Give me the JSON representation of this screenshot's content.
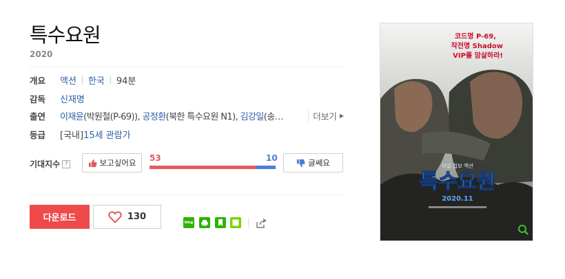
{
  "movie": {
    "title": "특수요원",
    "year": "2020"
  },
  "info": {
    "overview_label": "개요",
    "genre": "액션",
    "country": "한국",
    "runtime": "94분",
    "director_label": "감독",
    "director": "신재명",
    "cast_label": "출연",
    "cast": [
      {
        "name": "이재윤",
        "role": "(박원철(P-69)), "
      },
      {
        "name": "공정환",
        "role": "(북한 특수요원 N1), "
      },
      {
        "name": "김강일",
        "role": "(송…"
      }
    ],
    "more_label": "더보기",
    "rating_label": "등급",
    "rating_prefix": "[국내] ",
    "rating": "15세 관람가"
  },
  "expect": {
    "label": "기대지수",
    "help": "?",
    "want_label": "보고싶어요",
    "no_label": "글쎄요",
    "want_count": "53",
    "no_count": "10",
    "want_ratio": 0.8413
  },
  "actions": {
    "download_label": "다운로드",
    "like_count": "130",
    "blog_label": "blog"
  },
  "poster": {
    "tagline": [
      "코드명 P-69,",
      "작전명 Shadow",
      "VIP를 암살하라!"
    ],
    "subtitle": "리얼 첩보 액션",
    "title": "특수요원",
    "date": "2020.11"
  },
  "colors": {
    "accent_red": "#ee4a4a",
    "link_blue": "#2b5fa8",
    "no_blue": "#4a7fd6",
    "share_green": "#2db400"
  }
}
